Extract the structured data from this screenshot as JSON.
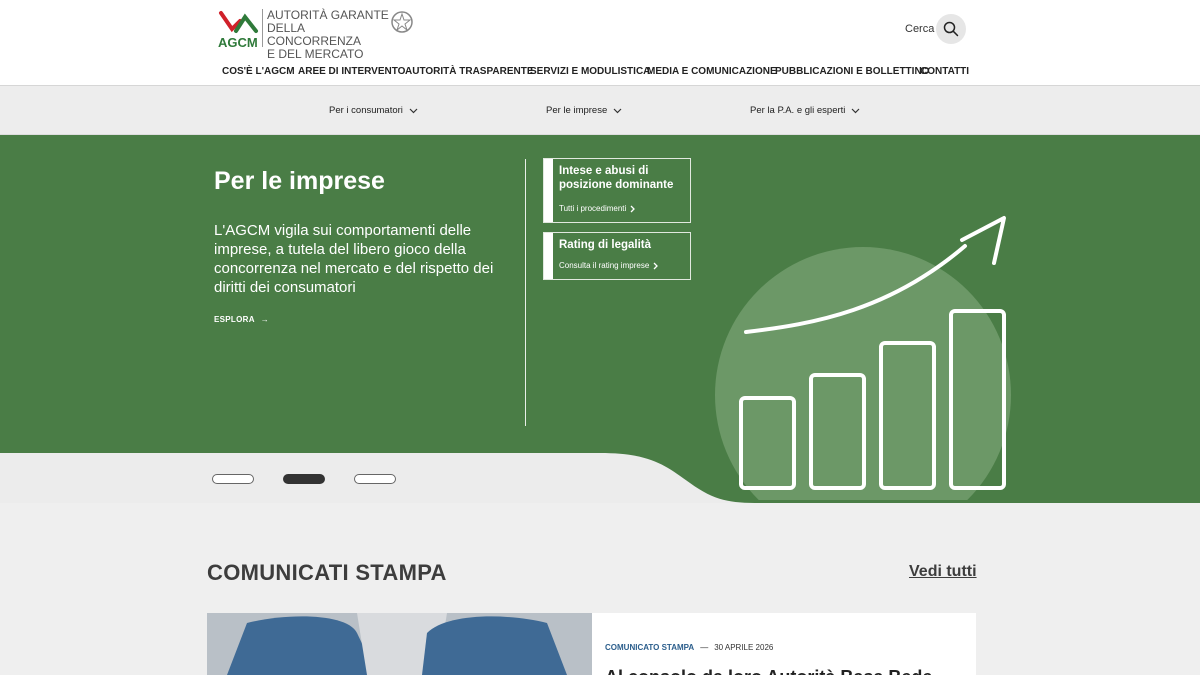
{
  "header": {
    "logo_text": "AGCM",
    "authority_name": [
      "Autorità Garante",
      "della Concorrenza",
      "e del Mercato"
    ],
    "search_label": "Cerca"
  },
  "main_nav": [
    "COS'È L'AGCM",
    "AREE DI INTERVENTO",
    "AUTORITÀ TRASPARENTE",
    "SERVIZI E MODULISTICA",
    "MEDIA E COMUNICAZIONE",
    "PUBBLICAZIONI E BOLLETTINO",
    "CONTATTI"
  ],
  "sub_nav": [
    "Per i consumatori",
    "Per le imprese",
    "Per la P.A. e gli esperti"
  ],
  "hero": {
    "title": "Per le imprese",
    "text": "L'AGCM vigila sui comportamenti delle imprese, a tutela del libero gioco della concorrenza nel mercato e del rispetto dei diritti dei consumatori",
    "cta": "ESPLORA",
    "cards": [
      {
        "title": "Intese e abusi di posizione dominante",
        "link": "Tutti i procedimenti"
      },
      {
        "title": "Rating di legalità",
        "link": "Consulta il rating imprese"
      }
    ]
  },
  "carousel": {
    "slides": 3,
    "active_index": 1
  },
  "press": {
    "title": "COMUNICATI STAMPA",
    "see_all": "Vedi tutti",
    "item": {
      "category": "COMUNICATO STAMPA",
      "date": "30 APRILE 2026",
      "headline": "Al consolo da loro Autorità Basa Bede"
    }
  },
  "colors": {
    "brand_green": "#4a7d46",
    "logo_red": "#d0202a",
    "logo_green": "#2f7a3a",
    "news_category_blue": "#2b5e8c"
  }
}
